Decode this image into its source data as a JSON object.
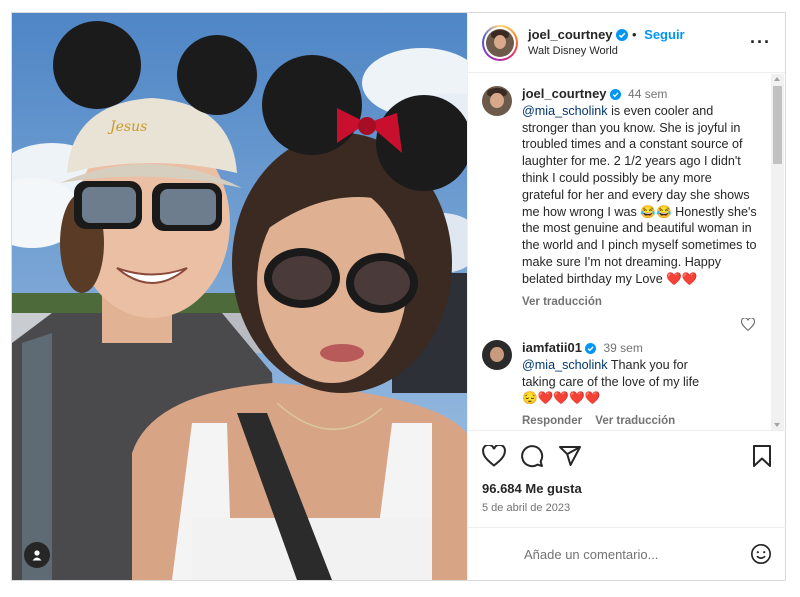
{
  "post": {
    "photo_alt": "selfie",
    "author": "joel_courtney",
    "follow_label": "Seguir",
    "location": "Walt Disney World",
    "more_icon": "more-horizontal-icon"
  },
  "comments": [
    {
      "username": "joel_courtney",
      "time": "44 sem",
      "mention": "@mia_scholink",
      "text": " is even cooler and stronger than you know. She is joyful in troubled times and a constant source of laughter for me. 2 1/2 years ago I didn't think I could possibly be any more grateful for her and every day she shows me how wrong I was 😂😂 Honestly she's the most genuine and beautiful woman in the world and I pinch myself sometimes to make sure I'm not dreaming. Happy belated birthday my Love ❤️❤️",
      "translate_label": "Ver traducción"
    },
    {
      "username": "iamfatii01",
      "time": "39 sem",
      "mention": "@mia_scholink",
      "text": " Thank you for taking care of the love of my life",
      "emojis": "😔❤️❤️❤️❤️",
      "reply_label": "Responder",
      "translate_label": "Ver traducción"
    }
  ],
  "stats": {
    "likes": "96.684 Me gusta",
    "date": "5 de abril de 2023"
  },
  "composer": {
    "placeholder": "Añade un comentario..."
  },
  "colors": {
    "accent": "#0095f6",
    "verified": "#0095f6",
    "heart": "#e0245e",
    "mention": "#00376b"
  }
}
